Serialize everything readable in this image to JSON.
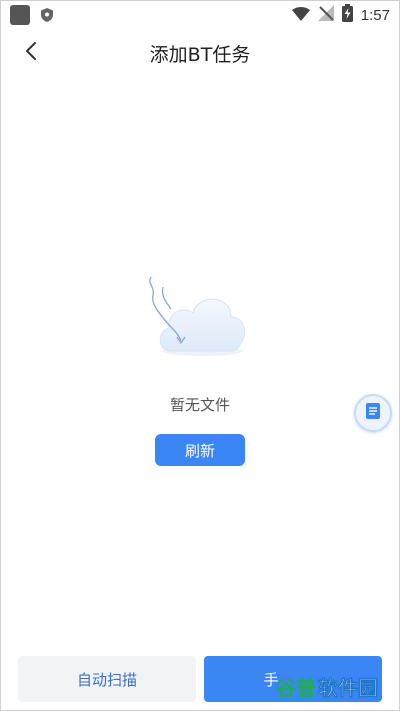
{
  "status_bar": {
    "time": "1:57"
  },
  "header": {
    "title": "添加BT任务"
  },
  "empty_state": {
    "message": "暂无文件",
    "refresh_label": "刷新"
  },
  "bottom": {
    "auto_scan_label": "自动扫描",
    "manual_label": "手"
  },
  "watermark": {
    "part1": "谷普",
    "part2": "软件园"
  },
  "icons": {
    "back": "chevron-left-icon",
    "cloud": "empty-cloud-icon",
    "doc": "document-icon",
    "wifi": "wifi-icon",
    "battery": "battery-charging-icon"
  },
  "colors": {
    "accent": "#3b86f5",
    "secondary_text": "#3b6fc9"
  }
}
